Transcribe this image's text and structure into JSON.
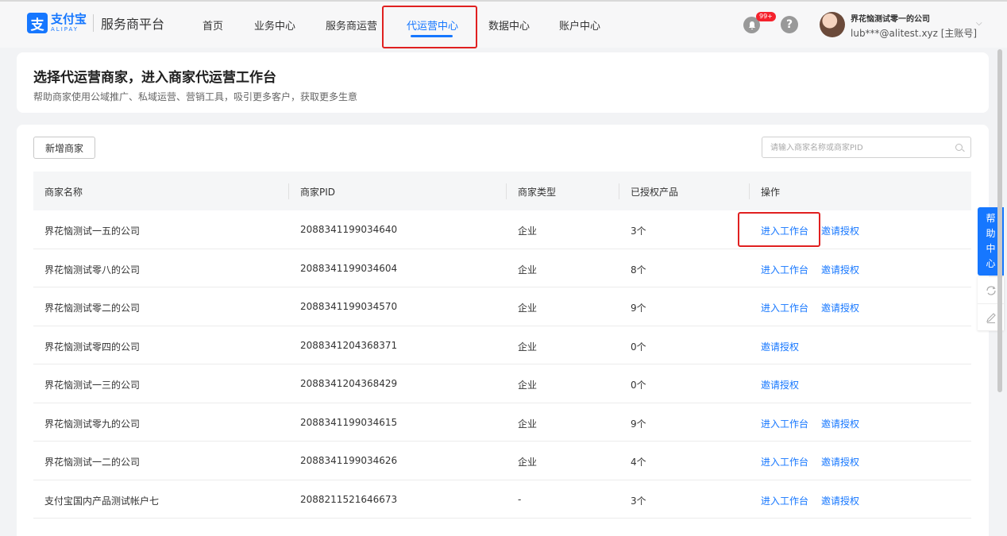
{
  "brand": {
    "logo_glyph": "支",
    "logo_cn": "支付宝",
    "logo_en": "ALIPAY",
    "platform_name": "服务商平台",
    "color": "#1677ff"
  },
  "nav": {
    "items": [
      {
        "label": "首页"
      },
      {
        "label": "业务中心"
      },
      {
        "label": "服务商运营"
      },
      {
        "label": "代运营中心",
        "active": true
      },
      {
        "label": "数据中心"
      },
      {
        "label": "账户中心"
      }
    ]
  },
  "topbar": {
    "notification_badge": "99+",
    "help_glyph": "?",
    "account_name": "界花恼测试零一的公司",
    "account_id": "lub***@alitest.xyz [主账号]",
    "chevron": "⌵"
  },
  "header": {
    "title": "选择代运营商家，进入商家代运营工作台",
    "subtitle": "帮助商家使用公域推广、私域运营、营销工具，吸引更多客户，获取更多生意"
  },
  "toolbar": {
    "add_label": "新增商家",
    "search_placeholder": "请输入商家名称或商家PID"
  },
  "table": {
    "columns": [
      "商家名称",
      "商家PID",
      "商家类型",
      "已授权产品",
      "操作"
    ],
    "rows": [
      {
        "name": "界花恼测试一五的公司",
        "pid": "2088341199034640",
        "type": "企业",
        "products": "3个",
        "enter": "进入工作台",
        "invite": "邀请授权"
      },
      {
        "name": "界花恼测试零八的公司",
        "pid": "2088341199034604",
        "type": "企业",
        "products": "8个",
        "enter": "进入工作台",
        "invite": "邀请授权"
      },
      {
        "name": "界花恼测试零二的公司",
        "pid": "2088341199034570",
        "type": "企业",
        "products": "9个",
        "enter": "进入工作台",
        "invite": "邀请授权"
      },
      {
        "name": "界花恼测试零四的公司",
        "pid": "2088341204368371",
        "type": "企业",
        "products": "0个",
        "enter": "",
        "invite": "邀请授权"
      },
      {
        "name": "界花恼测试一三的公司",
        "pid": "2088341204368429",
        "type": "企业",
        "products": "0个",
        "enter": "",
        "invite": "邀请授权"
      },
      {
        "name": "界花恼测试零九的公司",
        "pid": "2088341199034615",
        "type": "企业",
        "products": "9个",
        "enter": "进入工作台",
        "invite": "邀请授权"
      },
      {
        "name": "界花恼测试一二的公司",
        "pid": "2088341199034626",
        "type": "企业",
        "products": "4个",
        "enter": "进入工作台",
        "invite": "邀请授权"
      },
      {
        "name": "支付宝国内产品测试帐户七",
        "pid": "2088211521646673",
        "type": "-",
        "products": "3个",
        "enter": "进入工作台",
        "invite": "邀请授权"
      }
    ]
  },
  "side": {
    "help_chars": [
      "帮",
      "助",
      "中",
      "心"
    ],
    "tool_icons": [
      "refresh-icon",
      "edit-icon"
    ]
  },
  "highlight_color": "#e02020"
}
